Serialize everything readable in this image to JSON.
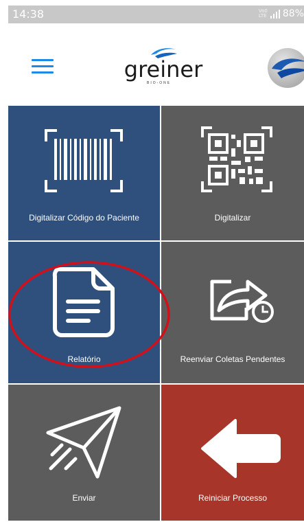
{
  "status_bar": {
    "time": "14:38",
    "network_top": "Vo0",
    "network_bottom": "LTE",
    "battery": "88%",
    "icons": [
      "signal-icon",
      "battery-icon"
    ]
  },
  "app_bar": {
    "menu_icon": "hamburger-menu-icon",
    "logo_word": "greiner",
    "logo_sub": "BIO-ONE",
    "avatar_icon": "greiner-swoosh-icon"
  },
  "colors": {
    "blue_tile": "#2f4f7d",
    "gray_tile": "#5c5c5c",
    "red_tile": "#a8352a",
    "menu_blue": "#1e88e5",
    "annotation_red": "#d0111b"
  },
  "tiles": [
    {
      "label": "Digitalizar Código do Paciente",
      "icon": "barcode-scan-icon"
    },
    {
      "label": "Digitalizar",
      "icon": "qr-code-scan-icon"
    },
    {
      "label": "Relatório",
      "icon": "document-icon"
    },
    {
      "label": "Reenviar Coletas Pendentes",
      "icon": "resend-clock-icon"
    },
    {
      "label": "Enviar",
      "icon": "paper-plane-icon"
    },
    {
      "label": "Reiniciar Processo",
      "icon": "arrow-left-icon"
    }
  ]
}
